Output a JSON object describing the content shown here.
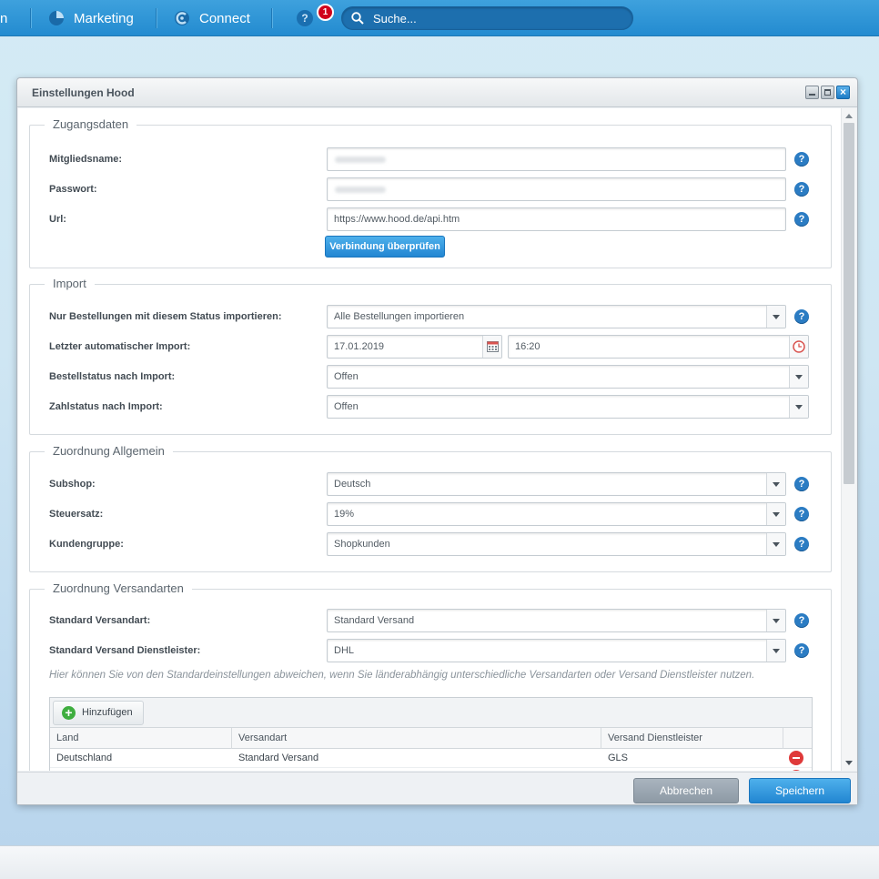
{
  "topbar": {
    "partial_item": "n",
    "marketing": "Marketing",
    "connect": "Connect",
    "help": "?",
    "notification_count": "1",
    "search_placeholder": "Suche..."
  },
  "window": {
    "title": "Einstellungen Hood"
  },
  "zugangsdaten": {
    "legend": "Zugangsdaten",
    "mitgliedsname_label": "Mitgliedsname:",
    "mitgliedsname_value": "",
    "passwort_label": "Passwort:",
    "passwort_value": "",
    "url_label": "Url:",
    "url_value": "https://www.hood.de/api.htm",
    "verify_button": "Verbindung überprüfen"
  },
  "import": {
    "legend": "Import",
    "status_label": "Nur Bestellungen mit diesem Status importieren:",
    "status_value": "Alle Bestellungen importieren",
    "last_import_label": "Letzter automatischer Import:",
    "last_import_date": "17.01.2019",
    "last_import_time": "16:20",
    "order_status_label": "Bestellstatus nach Import:",
    "order_status_value": "Offen",
    "payment_status_label": "Zahlstatus nach Import:",
    "payment_status_value": "Offen"
  },
  "allgemein": {
    "legend": "Zuordnung Allgemein",
    "subshop_label": "Subshop:",
    "subshop_value": "Deutsch",
    "steuersatz_label": "Steuersatz:",
    "steuersatz_value": "19%",
    "kundengruppe_label": "Kundengruppe:",
    "kundengruppe_value": "Shopkunden"
  },
  "versandarten": {
    "legend": "Zuordnung Versandarten",
    "standard_label": "Standard Versandart:",
    "standard_value": "Standard Versand",
    "dienstleister_label": "Standard Versand Dienstleister:",
    "dienstleister_value": "DHL",
    "hint": "Hier können Sie von den Standardeinstellungen abweichen, wenn Sie länderabhängig unterschiedliche Versandarten oder Versand Dienstleister nutzen.",
    "add_button": "Hinzufügen",
    "columns": [
      "Land",
      "Versandart",
      "Versand Dienstleister"
    ],
    "rows": [
      [
        "Deutschland",
        "Standard Versand",
        "GLS"
      ]
    ]
  },
  "footer": {
    "cancel": "Abbrechen",
    "save": "Speichern"
  },
  "colors": {
    "topbar": "#238bd0",
    "accent": "#2286d2",
    "help_icon": "#2b7cc3",
    "badge": "#d0021b",
    "delete": "#df3a3a",
    "add": "#3fae3f"
  }
}
